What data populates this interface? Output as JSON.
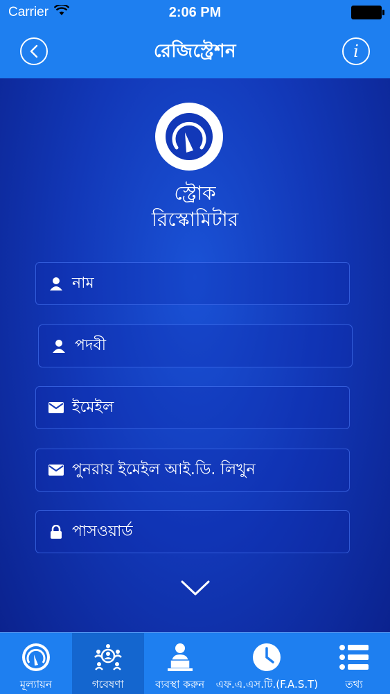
{
  "status_bar": {
    "carrier": "Carrier",
    "time": "2:06 PM"
  },
  "nav": {
    "title": "রেজিস্ট্রেশন",
    "info_label": "i"
  },
  "app": {
    "title_line1": "স্ট্রোক",
    "title_line2": "রিস্কোমিটার"
  },
  "form": {
    "name_placeholder": "নাম",
    "designation_placeholder": "পদবী",
    "email_placeholder": "ইমেইল",
    "email_confirm_placeholder": "পুনরায় ইমেইল আই.ডি. লিখুন",
    "password_placeholder": "পাসওয়ার্ড"
  },
  "tabs": [
    {
      "label": "মূল্যায়ন",
      "icon": "gauge-icon"
    },
    {
      "label": "গবেষণা",
      "icon": "research-group-icon",
      "active": true
    },
    {
      "label": "ব্যবস্থা করুন",
      "icon": "person-laptop-icon"
    },
    {
      "label": "এফ.এ.এস.টি.(F.A.S.T)",
      "icon": "clock-icon"
    },
    {
      "label": "তথ্য",
      "icon": "list-icon"
    }
  ],
  "colors": {
    "bar": "#1e7ff0",
    "active_tab": "#1466cf",
    "background": "#1238b8"
  }
}
